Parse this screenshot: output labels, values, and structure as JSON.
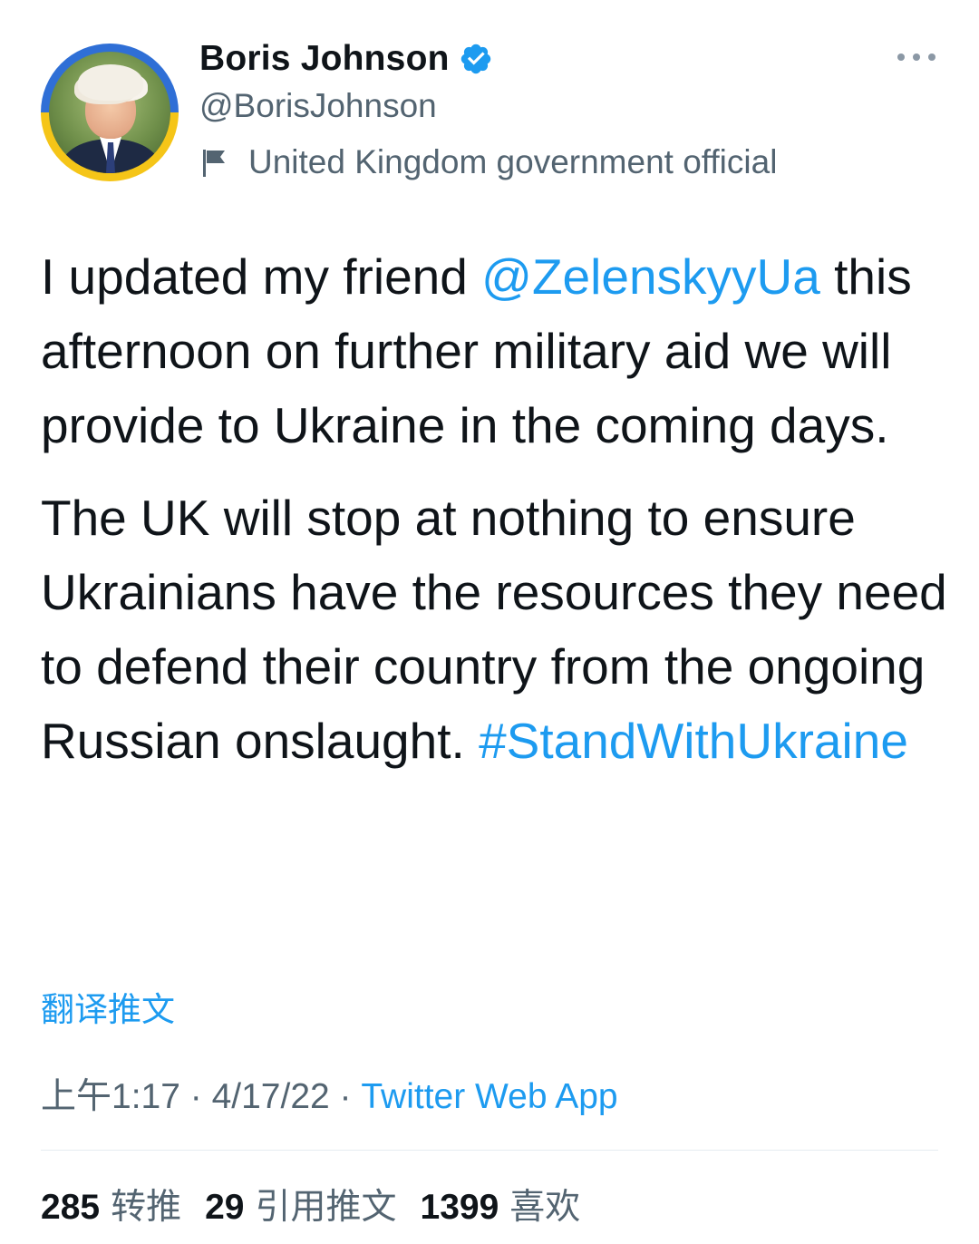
{
  "author": {
    "name": "Boris Johnson",
    "handle": "@BorisJohnson",
    "label": "United Kingdom government official",
    "avatar_icon": "profile-photo-with-ukraine-flag-ring",
    "verified_icon": "verified-badge-icon"
  },
  "tweet": {
    "paragraph1": {
      "before_mention": "I updated my friend ",
      "mention": "@ZelenskyyUa",
      "after_mention": " this afternoon on further military aid we will provide to Ukraine in the coming days."
    },
    "paragraph2": {
      "text": "The UK will stop at nothing to ensure Ukrainians have the resources they need to defend their country from the ongoing Russian onslaught. ",
      "hashtag": "#StandWithUkraine"
    }
  },
  "translate_label": "翻译推文",
  "meta": {
    "time": "上午1:17",
    "separator": " · ",
    "date": "4/17/22",
    "source": "Twitter Web App"
  },
  "stats": [
    {
      "count": "285",
      "label": "转推"
    },
    {
      "count": "29",
      "label": "引用推文"
    },
    {
      "count": "1399",
      "label": "喜欢"
    }
  ],
  "colors": {
    "link": "#1d9bf0",
    "secondary_text": "#536471",
    "primary_text": "#0f1419",
    "avatar_ring_blue": "#2f6fd6",
    "avatar_ring_yellow": "#f5c518"
  }
}
